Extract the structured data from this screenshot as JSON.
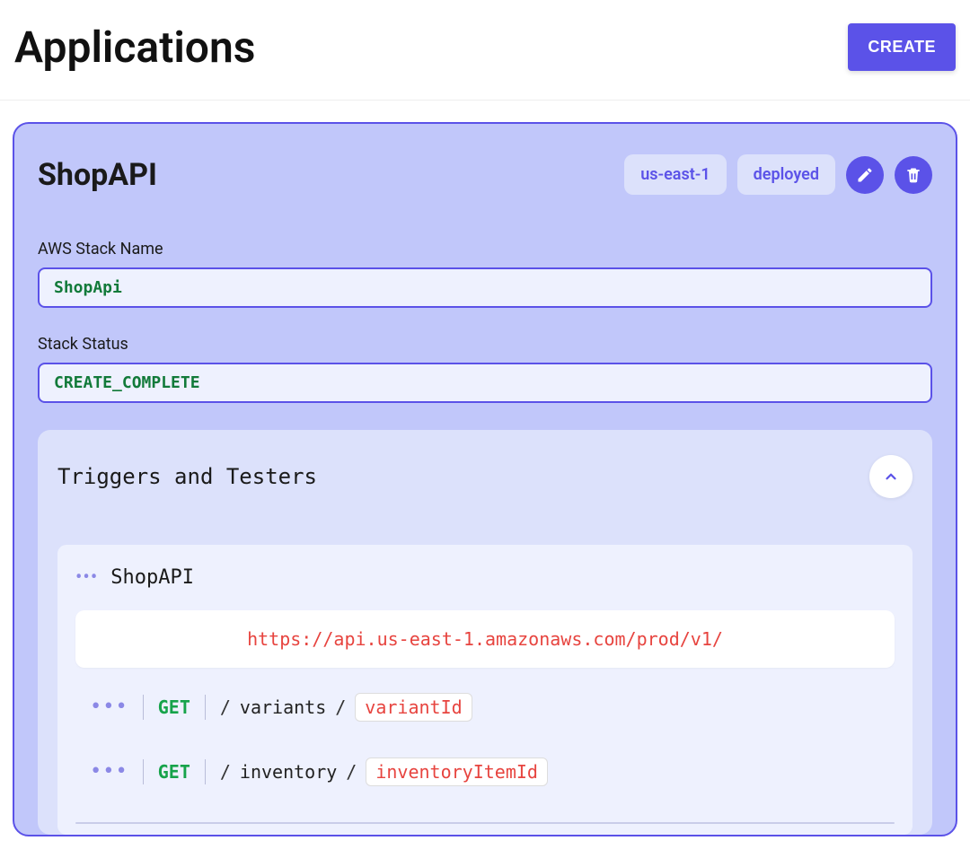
{
  "header": {
    "title": "Applications",
    "create_label": "CREATE"
  },
  "card": {
    "title": "ShopAPI",
    "region": "us-east-1",
    "status_pill": "deployed",
    "fields": {
      "stack_name_label": "AWS Stack Name",
      "stack_name_value": "ShopApi",
      "stack_status_label": "Stack Status",
      "stack_status_value": "CREATE_COMPLETE"
    }
  },
  "triggers": {
    "title": "Triggers and Testers",
    "api_name": "ShopAPI",
    "base_url": "https://api.us-east-1.amazonaws.com/prod/v1/",
    "endpoints": [
      {
        "method": "GET",
        "segment": "variants",
        "param": "variantId"
      },
      {
        "method": "GET",
        "segment": "inventory",
        "param": "inventoryItemId"
      }
    ]
  },
  "icons": {
    "edit": "edit",
    "delete": "delete",
    "chevron_up": "chevron-up",
    "menu_dots": "..."
  },
  "colors": {
    "primary": "#5B52E8",
    "card_bg": "#C1C7FA",
    "panel_bg": "#DCE1FB",
    "inner_bg": "#EEF1FE",
    "success": "#127A3A",
    "method_green": "#16A34A",
    "url_red": "#E7443F"
  }
}
